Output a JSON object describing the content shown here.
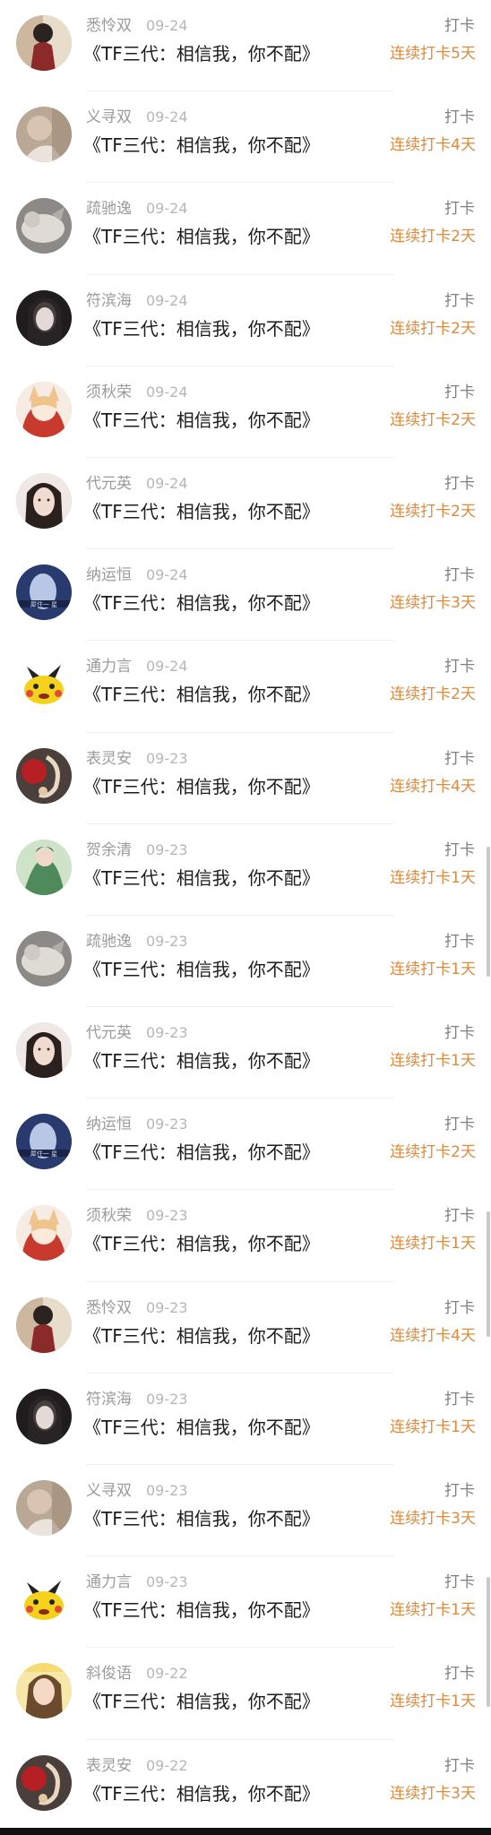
{
  "checkins": [
    {
      "name": "悉怜双",
      "date": "09-24",
      "title": "《TF三代：相信我，你不配》",
      "tag": "打卡",
      "streak": "连续打卡5天",
      "avatar": "avatar-dark-figure"
    },
    {
      "name": "义寻双",
      "date": "09-24",
      "title": "《TF三代：相信我，你不配》",
      "tag": "打卡",
      "streak": "连续打卡4天",
      "avatar": "avatar-blurry-girl"
    },
    {
      "name": "疏驰逸",
      "date": "09-24",
      "title": "《TF三代：相信我，你不配》",
      "tag": "打卡",
      "streak": "连续打卡2天",
      "avatar": "avatar-cat"
    },
    {
      "name": "符滨海",
      "date": "09-24",
      "title": "《TF三代：相信我，你不配》",
      "tag": "打卡",
      "streak": "连续打卡2天",
      "avatar": "avatar-dark-girl"
    },
    {
      "name": "须秋荣",
      "date": "09-24",
      "title": "《TF三代：相信我，你不配》",
      "tag": "打卡",
      "streak": "连续打卡2天",
      "avatar": "avatar-anime-fox"
    },
    {
      "name": "代元英",
      "date": "09-24",
      "title": "《TF三代：相信我，你不配》",
      "tag": "打卡",
      "streak": "连续打卡2天",
      "avatar": "avatar-girl-portrait"
    },
    {
      "name": "纳运恒",
      "date": "09-24",
      "title": "《TF三代：相信我，你不配》",
      "tag": "打卡",
      "streak": "连续打卡3天",
      "avatar": "avatar-blue-girl"
    },
    {
      "name": "通力言",
      "date": "09-24",
      "title": "《TF三代：相信我，你不配》",
      "tag": "打卡",
      "streak": "连续打卡2天",
      "avatar": "avatar-pikachu"
    },
    {
      "name": "表灵安",
      "date": "09-23",
      "title": "《TF三代：相信我，你不配》",
      "tag": "打卡",
      "streak": "连续打卡4天",
      "avatar": "avatar-red-ornament"
    },
    {
      "name": "贺余清",
      "date": "09-23",
      "title": "《TF三代：相信我，你不配》",
      "tag": "打卡",
      "streak": "连续打卡1天",
      "avatar": "avatar-green-figure"
    },
    {
      "name": "疏驰逸",
      "date": "09-23",
      "title": "《TF三代：相信我，你不配》",
      "tag": "打卡",
      "streak": "连续打卡1天",
      "avatar": "avatar-cat"
    },
    {
      "name": "代元英",
      "date": "09-23",
      "title": "《TF三代：相信我，你不配》",
      "tag": "打卡",
      "streak": "连续打卡1天",
      "avatar": "avatar-girl-portrait"
    },
    {
      "name": "纳运恒",
      "date": "09-23",
      "title": "《TF三代：相信我，你不配》",
      "tag": "打卡",
      "streak": "连续打卡2天",
      "avatar": "avatar-blue-girl"
    },
    {
      "name": "须秋荣",
      "date": "09-23",
      "title": "《TF三代：相信我，你不配》",
      "tag": "打卡",
      "streak": "连续打卡1天",
      "avatar": "avatar-anime-fox"
    },
    {
      "name": "悉怜双",
      "date": "09-23",
      "title": "《TF三代：相信我，你不配》",
      "tag": "打卡",
      "streak": "连续打卡4天",
      "avatar": "avatar-dark-figure"
    },
    {
      "name": "符滨海",
      "date": "09-23",
      "title": "《TF三代：相信我，你不配》",
      "tag": "打卡",
      "streak": "连续打卡1天",
      "avatar": "avatar-dark-girl"
    },
    {
      "name": "义寻双",
      "date": "09-23",
      "title": "《TF三代：相信我，你不配》",
      "tag": "打卡",
      "streak": "连续打卡3天",
      "avatar": "avatar-blurry-girl"
    },
    {
      "name": "通力言",
      "date": "09-23",
      "title": "《TF三代：相信我，你不配》",
      "tag": "打卡",
      "streak": "连续打卡1天",
      "avatar": "avatar-pikachu"
    },
    {
      "name": "斜俊语",
      "date": "09-22",
      "title": "《TF三代：相信我，你不配》",
      "tag": "打卡",
      "streak": "连续打卡1天",
      "avatar": "avatar-yellow-girl"
    },
    {
      "name": "表灵安",
      "date": "09-22",
      "title": "《TF三代：相信我，你不配》",
      "tag": "打卡",
      "streak": "连续打卡3天",
      "avatar": "avatar-red-ornament"
    }
  ],
  "colors": {
    "streak": "#e08a3c",
    "name": "#9b9b9b",
    "title": "#1c1c1c"
  }
}
